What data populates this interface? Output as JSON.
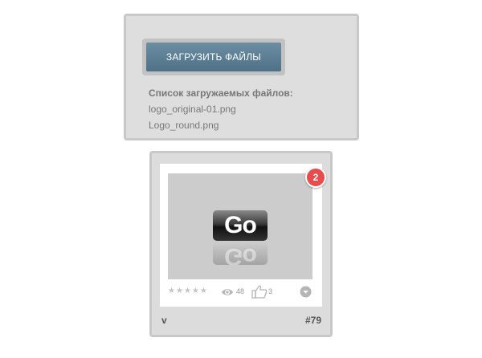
{
  "upload": {
    "button_label": "ЗАГРУЗИТЬ ФАЙЛЫ",
    "list_heading": "Список загружаемых файлов:",
    "files": [
      "logo_original-01.png",
      "Logo_round.png"
    ]
  },
  "card": {
    "thumbnail_text": "Go",
    "badge_count": "2",
    "rating_stars": 5,
    "views": "48",
    "likes": "3",
    "title": "v",
    "number": "#79"
  },
  "icons": {
    "views": "eye-icon",
    "likes": "thumbs-up-icon",
    "menu": "chevron-down-circle-icon",
    "rating": "star-icon"
  },
  "colors": {
    "button": "#5a7d93",
    "badge": "#e84c4c"
  }
}
